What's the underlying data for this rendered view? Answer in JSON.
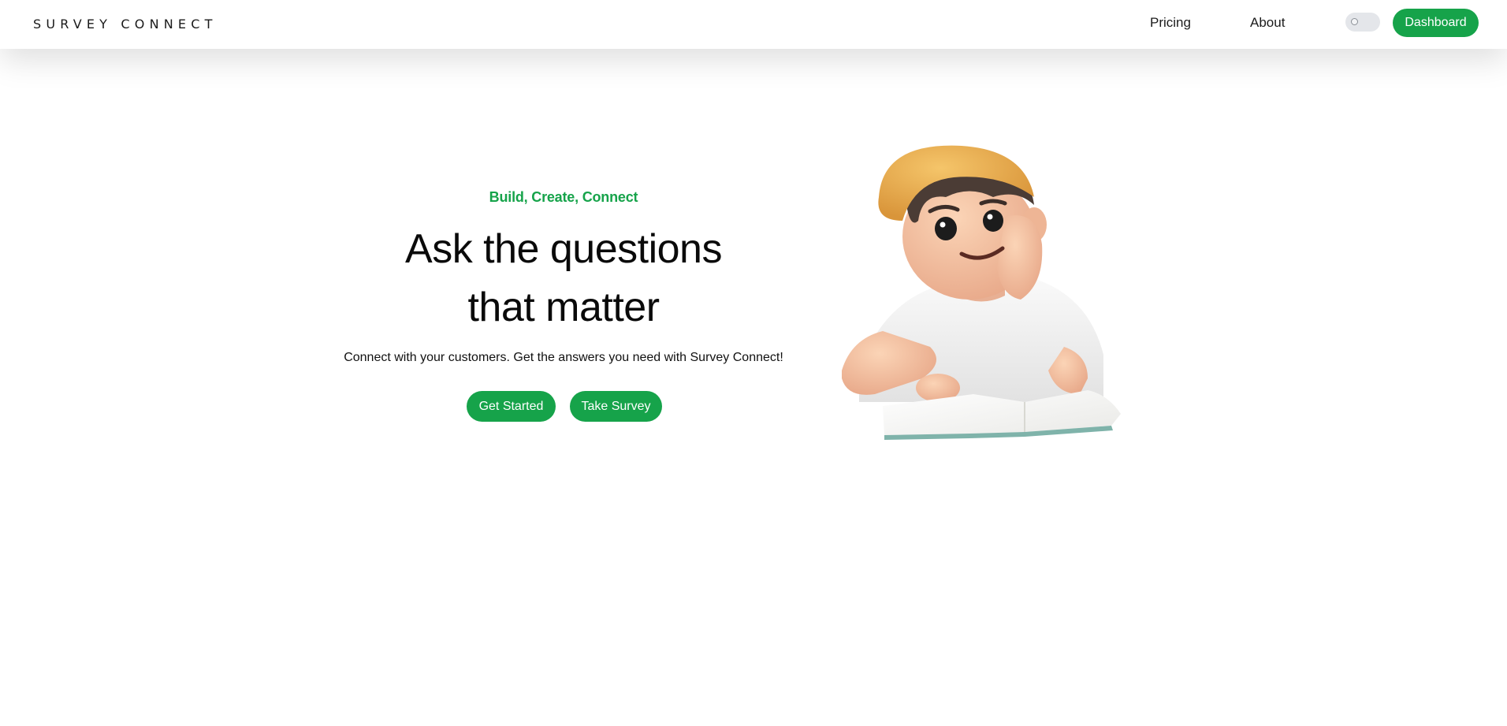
{
  "header": {
    "logo": "SURVEY CONNECT",
    "nav": {
      "pricing": "Pricing",
      "about": "About"
    },
    "theme_toggle_icon": "toggle-icon",
    "dashboard_button": "Dashboard"
  },
  "hero": {
    "tagline": "Build, Create, Connect",
    "headline_line1": "Ask the questions",
    "headline_line2": "that matter",
    "subtitle": "Connect with your customers. Get the answers you need with Survey Connect!",
    "buttons": {
      "get_started": "Get Started",
      "take_survey": "Take Survey"
    },
    "illustration": "boy-reading-book-illustration"
  },
  "colors": {
    "accent": "#16a34a",
    "text": "#111111",
    "background": "#ffffff"
  }
}
